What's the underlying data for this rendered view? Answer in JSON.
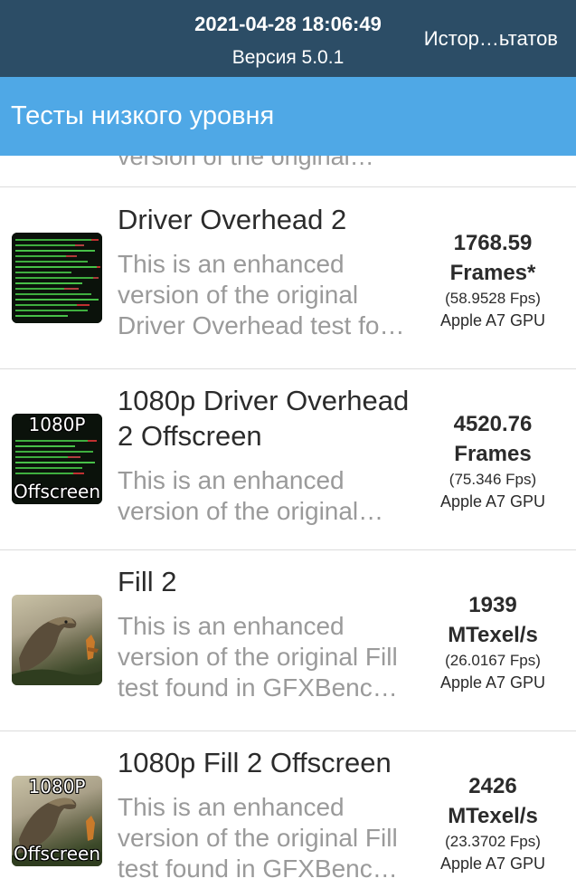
{
  "header": {
    "datetime": "2021-04-28 18:06:49",
    "version": "Версия 5.0.1",
    "history_button": "Истор…ьтатов"
  },
  "titlebar": {
    "title": "Тесты низкого уровня"
  },
  "partial_row": {
    "desc_tail": "version of the original…"
  },
  "tests": [
    {
      "name": "Driver Overhead 2",
      "description": "This is an enhanced version of the original Driver Overhead test fo…",
      "score": "1768.59",
      "unit": "Frames*",
      "fps": "(58.9528 Fps)",
      "gpu": "Apple A7 GPU",
      "thumbnail": "driver-overhead-thumbnail"
    },
    {
      "name": "1080p Driver Overhead 2 Offscreen",
      "description": "This is an enhanced version of the original…",
      "score": "4520.76",
      "unit": "Frames",
      "fps": "(75.346 Fps)",
      "gpu": "Apple A7 GPU",
      "badge_top": "1080P",
      "badge_bottom": "Offscreen",
      "thumbnail": "driver-overhead-offscreen-thumbnail"
    },
    {
      "name": "Fill 2",
      "description": "This is an enhanced version of the original Fill test found in GFXBenc…",
      "score": "1939",
      "unit": "MTexel/s",
      "fps": "(26.0167 Fps)",
      "gpu": "Apple A7 GPU",
      "thumbnail": "dinosaur-thumbnail"
    },
    {
      "name": "1080p Fill 2 Offscreen",
      "description": "This is an enhanced version of the original Fill test found in GFXBenc…",
      "score": "2426",
      "unit": "MTexel/s",
      "fps": "(23.3702 Fps)",
      "gpu": "Apple A7 GPU",
      "badge_top": "1080P",
      "badge_bottom": "Offscreen",
      "thumbnail": "dinosaur-offscreen-thumbnail"
    }
  ],
  "colors": {
    "header_bg": "#2c4d66",
    "titlebar_bg": "#4fa8e6",
    "description_text": "#9a9a9a"
  }
}
